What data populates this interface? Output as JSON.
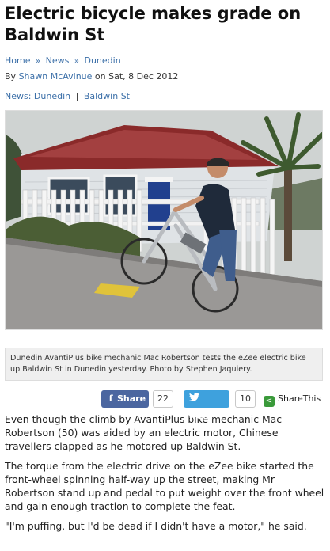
{
  "article": {
    "title": "Electric bicycle makes grade on Baldwin St",
    "breadcrumb": [
      "Home",
      "News",
      "Dunedin"
    ],
    "byline_prefix": "By",
    "author": "Shawn McAvinue",
    "date_prefix": "on Sat, 8 Dec 2012",
    "categories": [
      "News: Dunedin",
      "Baldwin St"
    ],
    "caption": "Dunedin AvantiPlus bike mechanic Mac Robertson tests the eZee electric bike up Baldwin St in Dunedin yesterday. Photo by Stephen Jaquiery.",
    "paragraphs": [
      "Even though the climb by AvantiPlus bike mechanic Mac Robertson (50) was aided by an electric motor, Chinese travellers clapped as he motored up Baldwin St.",
      "The torque from the electric drive on the eZee bike started the front-wheel spinning half-way up the street, making Mr Robertson stand up and pedal to put weight over the front wheel and gain enough traction to complete the feat.",
      "\"I'm puffing, but I'd be dead if I didn't have a motor,\" he said."
    ]
  },
  "share": {
    "facebook_label": "Share",
    "facebook_count": "22",
    "twitter_label": "Tweet",
    "twitter_count": "10",
    "sharethis_label": "ShareThis"
  },
  "colors": {
    "link": "#3b6fa8",
    "facebook": "#4b66a0",
    "twitter": "#3ea1dd",
    "sharethis": "#3a9a3a"
  },
  "icons": {
    "facebook": "facebook-icon",
    "twitter": "twitter-bird-icon",
    "sharethis": "sharethis-icon",
    "breadcrumb_sep": "double-chevron-icon"
  }
}
